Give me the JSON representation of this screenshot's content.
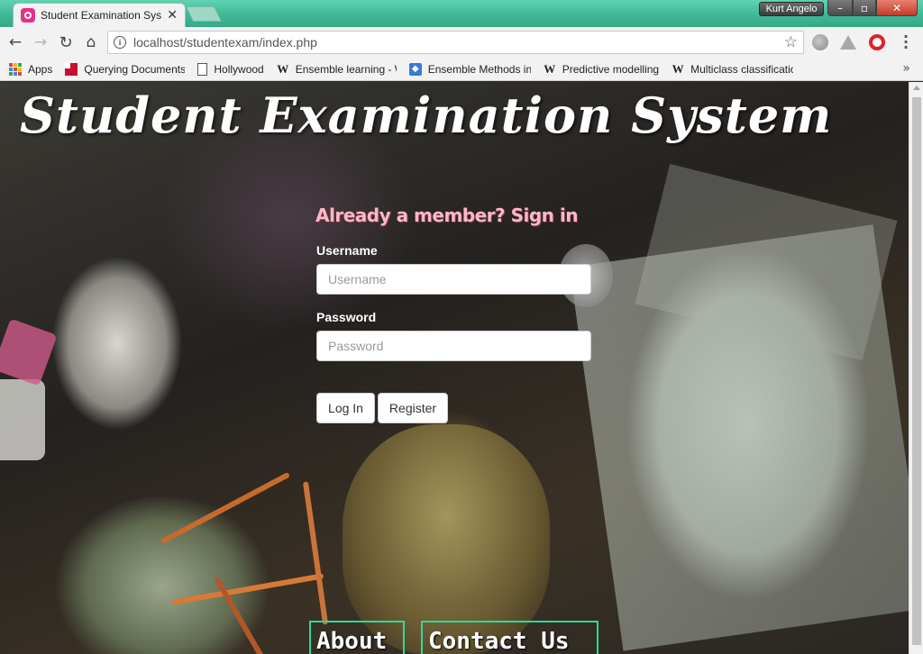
{
  "browser": {
    "tab": {
      "title": "Student Examination System"
    },
    "window": {
      "user": "Kurt Angelo"
    },
    "address_bar": {
      "url": "localhost/studentexam/index.php"
    },
    "bookmarks": [
      {
        "label": "Apps",
        "icon": "apps-grid-icon"
      },
      {
        "label": "Querying Documents",
        "icon": "red-square-icon"
      },
      {
        "label": "Hollywood",
        "icon": "page-icon"
      },
      {
        "label": "Ensemble learning - Wikipedia",
        "icon": "wikipedia-icon"
      },
      {
        "label": "Ensemble Methods in",
        "icon": "blue-diamond-icon"
      },
      {
        "label": "Predictive modelling",
        "icon": "wikipedia-icon"
      },
      {
        "label": "Multiclass classification",
        "icon": "wikipedia-icon"
      }
    ],
    "more_bookmarks": "»"
  },
  "page": {
    "title": "Student Examination System",
    "login": {
      "heading": "Already a member? Sign in",
      "username_label": "Username",
      "username_placeholder": "Username",
      "password_label": "Password",
      "password_placeholder": "Password",
      "login_button": "Log In",
      "register_button": "Register"
    },
    "footer": {
      "about": "About",
      "contact": "Contact Us"
    }
  },
  "colors": {
    "titlebar": "#3fb896",
    "heading_pink": "#ffb6c7",
    "footer_border": "#2fd99a"
  }
}
